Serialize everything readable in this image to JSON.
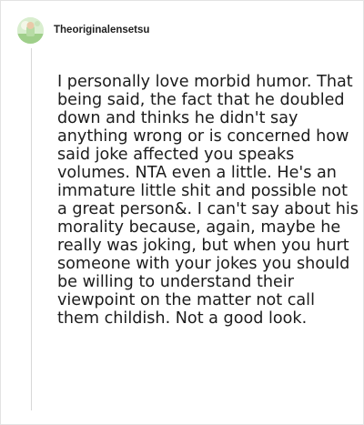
{
  "comment": {
    "author": "Theoriginalensetsu",
    "avatar_icon": "profile-avatar",
    "text": "I personally love morbid humor. That being said, the fact that he doubled down and thinks he didn't say anything wrong or is concerned how said joke affected you speaks volumes. NTA even a little. He's an immature little shit and possible not a great person&. I can't say about his morality because, again, maybe he really was joking, but when you hurt someone with your jokes you should be willing to understand their viewpoint on the matter not call them childish. Not a good look."
  },
  "colors": {
    "background": "#ffffff",
    "border": "#e3e3e3",
    "thread_line": "#d7d7d7",
    "text": "#1c1c1c"
  }
}
